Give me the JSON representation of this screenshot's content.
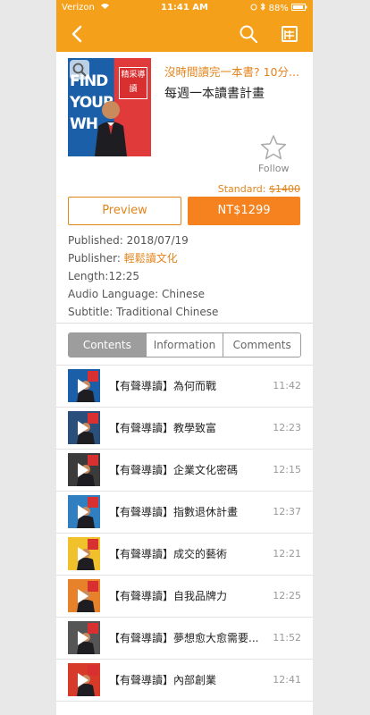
{
  "status": {
    "carrier": "Verizon",
    "time": "11:41 AM",
    "battery": "88%"
  },
  "nav": {
    "back_icon": "chevron-left-icon",
    "search_icon": "search-icon",
    "cart_icon": "cart-icon"
  },
  "book": {
    "title_line1": "沒時間讀完一本書? 10分...",
    "title_line2": "每週一本讀書計畫",
    "cover_words": [
      "FIND",
      "YOUR",
      "WH"
    ],
    "cover_badge": "精采導讀",
    "follow_label": "Follow"
  },
  "pricing": {
    "standard_label": "Standard:",
    "standard_price": "$1400",
    "preview_label": "Preview",
    "buy_label": "NT$1299"
  },
  "meta": {
    "published_label": "Published:",
    "published_value": "2018/07/19",
    "publisher_label": "Publisher:",
    "publisher_value": "輕鬆讀文化",
    "length_label": "Length:",
    "length_value": "12:25",
    "audio_label": "Audio Language:",
    "audio_value": "Chinese",
    "subtitle_label": "Subtitle:",
    "subtitle_value": "Traditional Chinese"
  },
  "tabs": [
    "Contents",
    "Information",
    "Comments"
  ],
  "chapters": [
    {
      "title": "【有聲導讀】為何而戰",
      "duration": "11:42",
      "color": "#1b5fa8"
    },
    {
      "title": "【有聲導讀】教學致富",
      "duration": "12:23",
      "color": "#2a4f7a"
    },
    {
      "title": "【有聲導讀】企業文化密碼",
      "duration": "12:15",
      "color": "#3b3b3b"
    },
    {
      "title": "【有聲導讀】指數退休計畫",
      "duration": "12:37",
      "color": "#2f7fc1"
    },
    {
      "title": "【有聲導讀】成交的藝術",
      "duration": "12:21",
      "color": "#f0c12a"
    },
    {
      "title": "【有聲導讀】自我品牌力",
      "duration": "12:25",
      "color": "#e8822a"
    },
    {
      "title": "【有聲導讀】夢想愈大愈需要...",
      "duration": "11:52",
      "color": "#555555"
    },
    {
      "title": "【有聲導讀】內部創業",
      "duration": "12:41",
      "color": "#d83a2a"
    }
  ],
  "colors": {
    "accent": "#f5a01a",
    "buy": "#f5821f",
    "link": "#e3841b"
  }
}
